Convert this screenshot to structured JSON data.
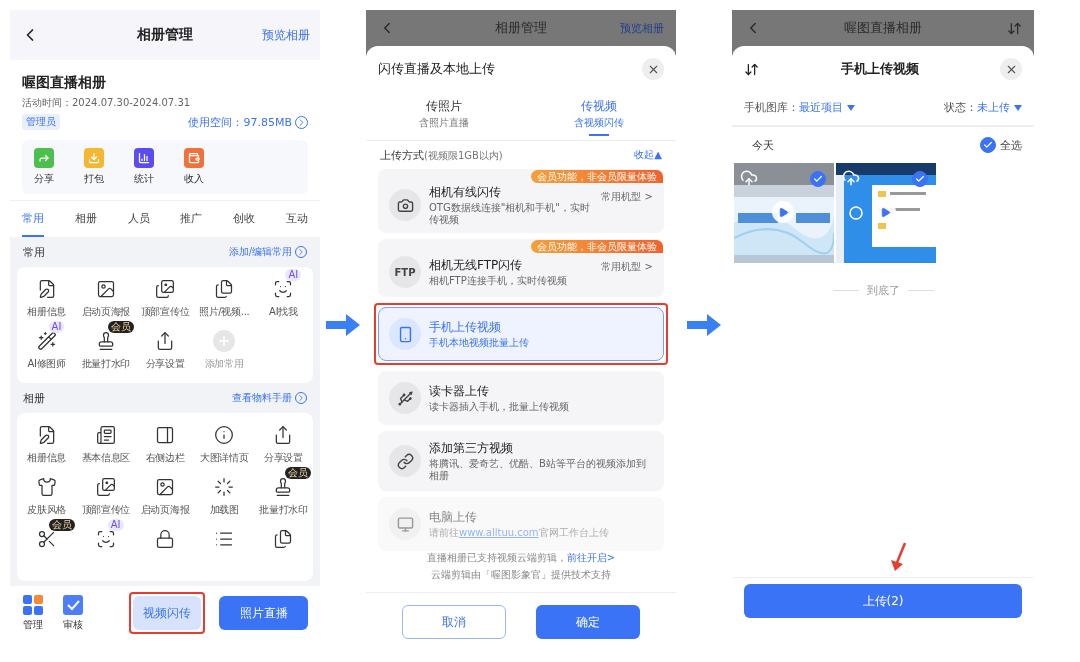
{
  "album_screen": {
    "header": {
      "title": "相册管理",
      "action": "预览相册"
    },
    "album": {
      "name": "喔图直播相册",
      "time": "活动时间：2024.07.30-2024.07.31",
      "role": "管理员",
      "storage": "使用空间：97.85MB"
    },
    "quick_actions": [
      {
        "label": "分享",
        "color": "#4cbf4f"
      },
      {
        "label": "打包",
        "color": "#f5b632"
      },
      {
        "label": "统计",
        "color": "#5b4cf0"
      },
      {
        "label": "收入",
        "color": "#f2703a"
      }
    ],
    "tabs": [
      {
        "label": "常用",
        "selected": true
      },
      {
        "label": "相册",
        "selected": false
      },
      {
        "label": "人员",
        "selected": false
      },
      {
        "label": "推广",
        "selected": false
      },
      {
        "label": "创收",
        "selected": false
      },
      {
        "label": "互动",
        "selected": false
      }
    ],
    "sections": [
      {
        "title": "常用",
        "link": "添加/编辑常用",
        "items": [
          {
            "label": "相册信息"
          },
          {
            "label": "启动页海报"
          },
          {
            "label": "顶部宣传位"
          },
          {
            "label": "照片/视频..."
          },
          {
            "label": "AI找我",
            "badge": {
              "label": "AI",
              "color": "#ece6ff"
            }
          },
          {
            "label": "AI修图师",
            "badge": {
              "label": "AI",
              "color": "#ece6ff"
            }
          },
          {
            "label": "批量打水印",
            "badge": {
              "label": "会员",
              "color": "#222222"
            }
          },
          {
            "label": "分享设置"
          },
          {
            "label": "添加常用",
            "kind": "add"
          }
        ]
      },
      {
        "title": "相册",
        "link": "查看物料手册",
        "items": [
          {
            "label": "相册信息"
          },
          {
            "label": "基本信息区"
          },
          {
            "label": "右侧边栏"
          },
          {
            "label": "大图详情页"
          },
          {
            "label": "分享设置"
          },
          {
            "label": "皮肤风格"
          },
          {
            "label": "顶部宣传位"
          },
          {
            "label": "启动页海报"
          },
          {
            "label": "加载图"
          },
          {
            "label": "批量打水印",
            "badge": {
              "label": "会员",
              "color": "#222222"
            }
          },
          {
            "kind": "feature",
            "badge": {
              "label": "会员",
              "color": "#222222"
            }
          },
          {
            "kind": "feature",
            "badge": {
              "label": "AI",
              "color": "#ece6ff"
            }
          },
          {
            "kind": "feature"
          },
          {
            "kind": "feature"
          },
          {
            "kind": "feature"
          }
        ]
      }
    ],
    "bottom_bar": {
      "nav": [
        {
          "label": "管理"
        },
        {
          "label": "审核"
        }
      ],
      "buttons": [
        {
          "label": "视频闪传",
          "kind": "secondary",
          "annotated": true
        },
        {
          "label": "照片直播",
          "kind": "primary",
          "annotated": false
        }
      ]
    }
  },
  "upload_sheet_screen": {
    "backdrop_header": {
      "title": "相册管理",
      "action": "预览相册"
    },
    "title": "闪传直播及本地上传",
    "tabs": [
      {
        "label": "传照片",
        "sub": "含照片直播",
        "selected": false
      },
      {
        "label": "传视频",
        "sub": "含视频闪传",
        "selected": true
      }
    ],
    "section": {
      "title": "上传方式",
      "note": "(视频限1GB以内)",
      "toggle": "收起▲"
    },
    "methods": [
      {
        "title": "相机有线闪传",
        "subtitle": "OTG数据线连接\"相机和手机\"，实时传视频",
        "badge": "会员功能，非会员限量体验",
        "extra": "常用机型 >",
        "selected": false,
        "disabled": false,
        "annotated": false
      },
      {
        "title": "相机无线FTP闪传",
        "subtitle": "相机FTP连接手机，实时传视频",
        "badge": "会员功能，非会员限量体验",
        "extra": "常用机型 >",
        "icon_text": "FTP",
        "selected": false,
        "disabled": false,
        "annotated": false
      },
      {
        "title": "手机上传视频",
        "subtitle": "手机本地视频批量上传",
        "selected": true,
        "disabled": false,
        "annotated": true
      },
      {
        "title": "读卡器上传",
        "subtitle": "读卡器插入手机，批量上传视频",
        "selected": false,
        "disabled": false,
        "annotated": false
      },
      {
        "title": "添加第三方视频",
        "subtitle": "将腾讯、爱奇艺、优酷、B站等平台的视频添加到相册",
        "selected": false,
        "disabled": false,
        "annotated": false
      },
      {
        "title": "电脑上传",
        "subtitle": "请前往",
        "link": "www.alltuu.com",
        "subtitle_after": "官网工作台上传",
        "selected": false,
        "disabled": true,
        "annotated": false
      }
    ],
    "note": {
      "text": "直播相册已支持视频云端剪辑，",
      "link": "前往开启>"
    },
    "credit": "云端剪辑由「喔图影象官」提供技术支持",
    "buttons": [
      {
        "label": "取消",
        "kind": "outline"
      },
      {
        "label": "确定",
        "kind": "primary"
      }
    ]
  },
  "video_picker_screen": {
    "backdrop_header": {
      "title": "喔图直播相册"
    },
    "title": "手机上传视频",
    "filters": [
      {
        "label": "手机图库：",
        "value": "最近项目"
      },
      {
        "label": "状态：",
        "value": "未上传"
      }
    ],
    "group": {
      "date": "今天",
      "select_all": {
        "label": "全选",
        "checked": true
      }
    },
    "videos": [
      {
        "kind": "picture",
        "selected": true
      },
      {
        "kind": "picture",
        "selected": true
      }
    ],
    "end_note": "到底了",
    "upload_button": "上传(2)"
  }
}
